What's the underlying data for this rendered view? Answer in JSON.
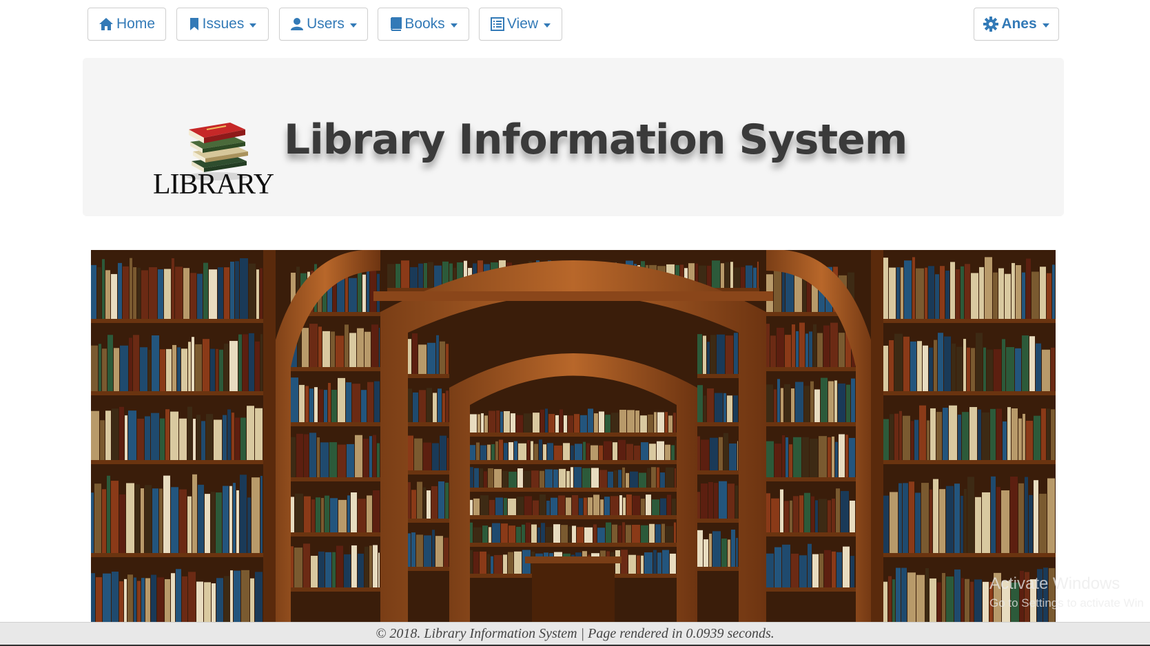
{
  "nav": {
    "home": {
      "label": "Home",
      "icon": "home-icon"
    },
    "issues": {
      "label": "Issues",
      "icon": "bookmark-icon"
    },
    "users": {
      "label": "Users",
      "icon": "user-icon"
    },
    "books": {
      "label": "Books",
      "icon": "book-icon"
    },
    "view": {
      "label": "View",
      "icon": "list-icon"
    },
    "account": {
      "label": "Anes",
      "icon": "gear-icon"
    }
  },
  "header": {
    "logo_text": "LIBRARY",
    "title": "Library Information System"
  },
  "hero": {
    "image": "library-bookshelves-arches-photo"
  },
  "footer": {
    "text": "© 2018. Library Information System | Page rendered in 0.0939 seconds."
  },
  "watermark": {
    "title": "Activate Windows",
    "subtitle": "Go to Settings to activate Win"
  },
  "colors": {
    "link": "#337ab7",
    "jumbotron_bg": "#f5f5f5",
    "footer_bg": "#e8e8e8"
  }
}
